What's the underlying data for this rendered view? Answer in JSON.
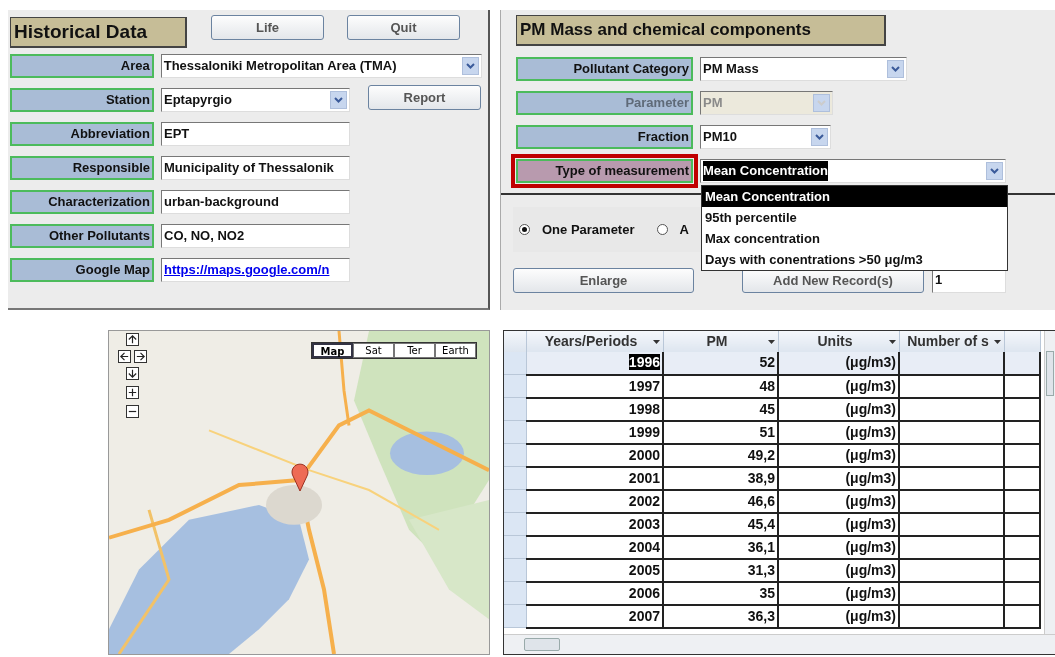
{
  "historical": {
    "title": "Historical Data",
    "buttons": [
      "Life",
      "Quit"
    ],
    "report_button": "Report",
    "fields": [
      {
        "label": "Area",
        "value": "Thessaloniki Metropolitan Area (TMA)",
        "kind": "combo"
      },
      {
        "label": "Station",
        "value": "Eptapyrgio",
        "kind": "combo"
      },
      {
        "label": "Abbreviation",
        "value": "EPT",
        "kind": "text"
      },
      {
        "label": "Responsible",
        "value": "Municipality of Thessalonik",
        "kind": "text"
      },
      {
        "label": "Characterization",
        "value": "urban-background",
        "kind": "text"
      },
      {
        "label": "Other Pollutants",
        "value": "CO, NO, NO2",
        "kind": "text"
      },
      {
        "label": "Google Map",
        "value": "https://maps.google.com/n",
        "kind": "link"
      }
    ]
  },
  "pm": {
    "title": "PM Mass and chemical components",
    "fields": [
      {
        "label": "Pollutant Category",
        "value": "PM Mass",
        "kind": "combo",
        "disabled": false,
        "outlined": false,
        "text_selected": false
      },
      {
        "label": "Parameter",
        "value": "PM",
        "kind": "combo",
        "disabled": true,
        "outlined": false,
        "text_selected": false
      },
      {
        "label": "Fraction",
        "value": "PM10",
        "kind": "combo",
        "disabled": false,
        "outlined": false,
        "text_selected": false
      },
      {
        "label": "Type of measurement",
        "value": "Mean Concentration",
        "kind": "combo",
        "disabled": false,
        "outlined": true,
        "text_selected": true
      }
    ],
    "dropdown_options": [
      {
        "label": "Mean Concentration",
        "selected": true
      },
      {
        "label": "95th percentile",
        "selected": false
      },
      {
        "label": "Max concentration",
        "selected": false
      },
      {
        "label": "Days with conentrations >50 μg/m3",
        "selected": false
      }
    ],
    "radio_options": [
      {
        "label": "One Parameter",
        "selected": true
      },
      {
        "label": "A",
        "selected": false
      }
    ],
    "buttons": [
      "Enlarge",
      "Add New Record(s)"
    ],
    "record_count": "1"
  },
  "map": {
    "map_types": [
      {
        "label": "Map",
        "selected": true
      },
      {
        "label": "Sat",
        "selected": false
      },
      {
        "label": "Ter",
        "selected": false
      },
      {
        "label": "Earth",
        "selected": false
      }
    ]
  },
  "table": {
    "columns": [
      "Years/Periods",
      "PM",
      "Units",
      "Number of s"
    ],
    "rows": [
      {
        "cells": [
          "1996",
          "52",
          "(μg/m3)",
          ""
        ],
        "selected": true
      },
      {
        "cells": [
          "1997",
          "48",
          "(μg/m3)",
          ""
        ],
        "selected": false
      },
      {
        "cells": [
          "1998",
          "45",
          "(μg/m3)",
          ""
        ],
        "selected": false
      },
      {
        "cells": [
          "1999",
          "51",
          "(μg/m3)",
          ""
        ],
        "selected": false
      },
      {
        "cells": [
          "2000",
          "49,2",
          "(μg/m3)",
          ""
        ],
        "selected": false
      },
      {
        "cells": [
          "2001",
          "38,9",
          "(μg/m3)",
          ""
        ],
        "selected": false
      },
      {
        "cells": [
          "2002",
          "46,6",
          "(μg/m3)",
          ""
        ],
        "selected": false
      },
      {
        "cells": [
          "2003",
          "45,4",
          "(μg/m3)",
          ""
        ],
        "selected": false
      },
      {
        "cells": [
          "2004",
          "36,1",
          "(μg/m3)",
          ""
        ],
        "selected": false
      },
      {
        "cells": [
          "2005",
          "31,3",
          "(μg/m3)",
          ""
        ],
        "selected": false
      },
      {
        "cells": [
          "2006",
          "35",
          "(μg/m3)",
          ""
        ],
        "selected": false
      },
      {
        "cells": [
          "2007",
          "36,3",
          "(μg/m3)",
          ""
        ],
        "selected": false
      }
    ]
  }
}
